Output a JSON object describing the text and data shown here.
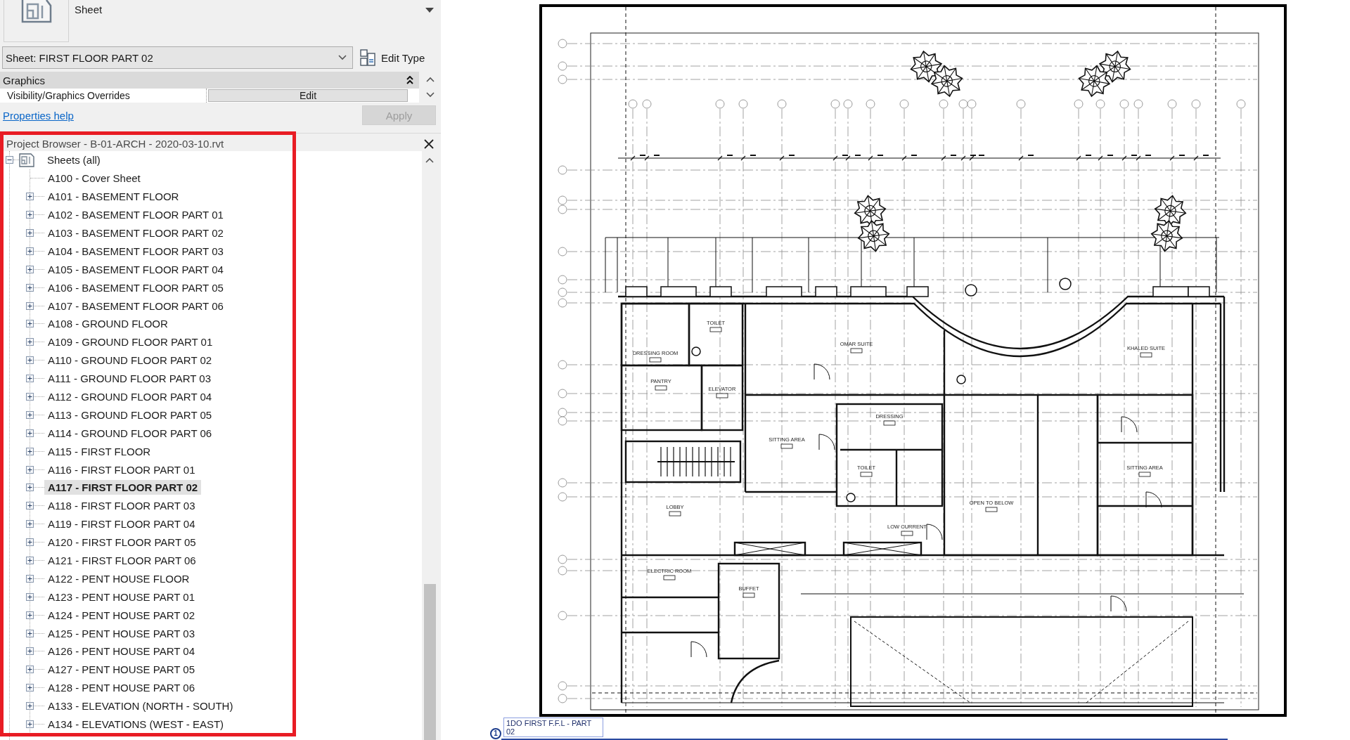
{
  "properties": {
    "type_selector": {
      "name": "Sheet"
    },
    "instance": {
      "value": "Sheet: FIRST FLOOR PART 02"
    },
    "edit_type": "Edit Type",
    "groups": [
      {
        "title": "Graphics",
        "expanded": true,
        "rows": [
          {
            "label": "Visibility/Graphics Overrides",
            "value": "Edit"
          }
        ]
      }
    ],
    "help_link": "Properties help",
    "apply": {
      "label": "Apply",
      "disabled": true
    }
  },
  "project_browser": {
    "title": "Project Browser - B-01-ARCH - 2020-03-10.rvt",
    "tree": [
      {
        "label": "Sheets (all)",
        "expanded": true,
        "selected": false,
        "children": [
          {
            "label": "A100 - Cover Sheet",
            "kind": "leaf",
            "selected": false
          },
          {
            "label": "A101 - BASEMENT FLOOR",
            "kind": "group",
            "expanded": false,
            "selected": false
          },
          {
            "label": "A102 - BASEMENT FLOOR PART 01",
            "kind": "group",
            "expanded": false,
            "selected": false
          },
          {
            "label": "A103 - BASEMENT FLOOR PART 02",
            "kind": "group",
            "expanded": false,
            "selected": false
          },
          {
            "label": "A104 - BASEMENT FLOOR PART 03",
            "kind": "group",
            "expanded": false,
            "selected": false
          },
          {
            "label": "A105 - BASEMENT FLOOR PART 04",
            "kind": "group",
            "expanded": false,
            "selected": false
          },
          {
            "label": "A106 - BASEMENT FLOOR PART 05",
            "kind": "group",
            "expanded": false,
            "selected": false
          },
          {
            "label": "A107 - BASEMENT FLOOR PART 06",
            "kind": "group",
            "expanded": false,
            "selected": false
          },
          {
            "label": "A108 - GROUND FLOOR",
            "kind": "group",
            "expanded": false,
            "selected": false
          },
          {
            "label": "A109 - GROUND FLOOR PART 01",
            "kind": "group",
            "expanded": false,
            "selected": false
          },
          {
            "label": "A110 - GROUND FLOOR PART 02",
            "kind": "group",
            "expanded": false,
            "selected": false
          },
          {
            "label": "A111 - GROUND FLOOR PART 03",
            "kind": "group",
            "expanded": false,
            "selected": false
          },
          {
            "label": "A112 - GROUND FLOOR PART 04",
            "kind": "group",
            "expanded": false,
            "selected": false
          },
          {
            "label": "A113 - GROUND FLOOR PART 05",
            "kind": "group",
            "expanded": false,
            "selected": false
          },
          {
            "label": "A114 - GROUND FLOOR PART 06",
            "kind": "group",
            "expanded": false,
            "selected": false
          },
          {
            "label": "A115 - FIRST FLOOR",
            "kind": "group",
            "expanded": false,
            "selected": false
          },
          {
            "label": "A116 - FIRST FLOOR PART 01",
            "kind": "group",
            "expanded": false,
            "selected": false
          },
          {
            "label": "A117 - FIRST FLOOR PART 02",
            "kind": "group",
            "expanded": false,
            "selected": true
          },
          {
            "label": "A118 - FIRST FLOOR PART 03",
            "kind": "group",
            "expanded": false,
            "selected": false
          },
          {
            "label": "A119 - FIRST FLOOR PART 04",
            "kind": "group",
            "expanded": false,
            "selected": false
          },
          {
            "label": "A120 - FIRST FLOOR PART 05",
            "kind": "group",
            "expanded": false,
            "selected": false
          },
          {
            "label": "A121 - FIRST FLOOR PART 06",
            "kind": "group",
            "expanded": false,
            "selected": false
          },
          {
            "label": "A122 - PENT HOUSE FLOOR",
            "kind": "group",
            "expanded": false,
            "selected": false
          },
          {
            "label": "A123 - PENT HOUSE PART 01",
            "kind": "group",
            "expanded": false,
            "selected": false
          },
          {
            "label": "A124 - PENT HOUSE PART 02",
            "kind": "group",
            "expanded": false,
            "selected": false
          },
          {
            "label": "A125 - PENT HOUSE PART 03",
            "kind": "group",
            "expanded": false,
            "selected": false
          },
          {
            "label": "A126 - PENT HOUSE PART 04",
            "kind": "group",
            "expanded": false,
            "selected": false
          },
          {
            "label": "A127 - PENT HOUSE PART 05",
            "kind": "group",
            "expanded": false,
            "selected": false
          },
          {
            "label": "A128 - PENT HOUSE PART 06",
            "kind": "group",
            "expanded": false,
            "selected": false
          },
          {
            "label": "A133 - ELEVATION (NORTH - SOUTH)",
            "kind": "group",
            "expanded": false,
            "selected": false
          },
          {
            "label": "A134 - ELEVATIONS (WEST - EAST)",
            "kind": "group",
            "expanded": false,
            "selected": false
          }
        ]
      }
    ]
  },
  "sheet_view": {
    "rooms": [
      {
        "name": "TOILET"
      },
      {
        "name": "OMAR SUITE"
      },
      {
        "name": "KHALED SUITE"
      },
      {
        "name": "DRESSING ROOM"
      },
      {
        "name": "PANTRY"
      },
      {
        "name": "ELEVATOR"
      },
      {
        "name": "SITTING AREA"
      },
      {
        "name": "DRESSING"
      },
      {
        "name": "TOILET"
      },
      {
        "name": "LOBBY"
      },
      {
        "name": "LOW CURRENT"
      },
      {
        "name": "OPEN TO BELOW"
      },
      {
        "name": "ELECTRIC ROOM"
      },
      {
        "name": "BUFFET"
      },
      {
        "name": "SITTING AREA"
      }
    ],
    "view_title": {
      "number": "1",
      "title": "1DO FIRST F.F.L - PART 02"
    }
  }
}
